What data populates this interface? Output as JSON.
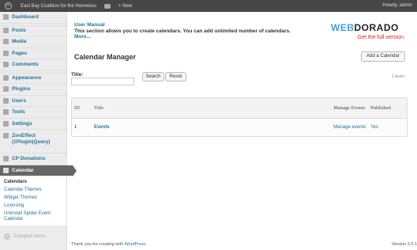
{
  "adminbar": {
    "wp_logo": "W",
    "site_name": "East Bay Coalition for the Homeless",
    "new_label": "+ New",
    "howdy": "Howdy, admin"
  },
  "sidebar": {
    "items": [
      {
        "label": "Dashboard",
        "icon": "dashboard-icon"
      },
      {
        "label": "Posts",
        "icon": "pin-icon"
      },
      {
        "label": "Media",
        "icon": "media-icon"
      },
      {
        "label": "Pages",
        "icon": "pages-icon"
      },
      {
        "label": "Comments",
        "icon": "comments-icon"
      },
      {
        "label": "Appearance",
        "icon": "appearance-icon"
      },
      {
        "label": "Plugins",
        "icon": "plugins-icon"
      },
      {
        "label": "Users",
        "icon": "users-icon"
      },
      {
        "label": "Tools",
        "icon": "tools-icon"
      },
      {
        "label": "Settings",
        "icon": "settings-icon"
      },
      {
        "label": "ZooEffect (1PluginjQuery)",
        "icon": "zooeffect-icon"
      },
      {
        "label": "CP Donations",
        "icon": "donations-icon"
      },
      {
        "label": "Calendar",
        "icon": "calendar-icon"
      }
    ],
    "submenu": [
      "Calendars",
      "Calendar Themes",
      "Widget Themes",
      "Licensing",
      "Uninstall Spider Event Calendar"
    ],
    "collapse_label": "Collapse menu"
  },
  "main": {
    "manual_title": "User Manual",
    "manual_text": "This section allows you to create calendars. You can add unlimited number of calendars.",
    "manual_more": "More...",
    "logo_brand_1": "WEB",
    "logo_brand_2": "DORADO",
    "logo_full": "Get the full version",
    "page_title": "Calendar Manager",
    "add_button": "Add a Calendar",
    "title_label": "Title:",
    "search_button": "Search",
    "reset_button": "Reset",
    "items_count": "1 items",
    "table": {
      "headers": {
        "id": "ID",
        "title": "Title",
        "manage": "Manage Events",
        "published": "Published"
      },
      "rows": [
        {
          "id": "1",
          "title": "Events",
          "manage": "Manage events",
          "published": "Yes"
        }
      ]
    },
    "footer_prefix": "Thank you for creating with ",
    "footer_link": "WordPress",
    "footer_suffix": ".",
    "version": "Version 3.5.1"
  },
  "colors": {
    "link": "#21759b",
    "adminbar": "#464646",
    "active_menu": "#666666",
    "full_version": "#e02020"
  }
}
